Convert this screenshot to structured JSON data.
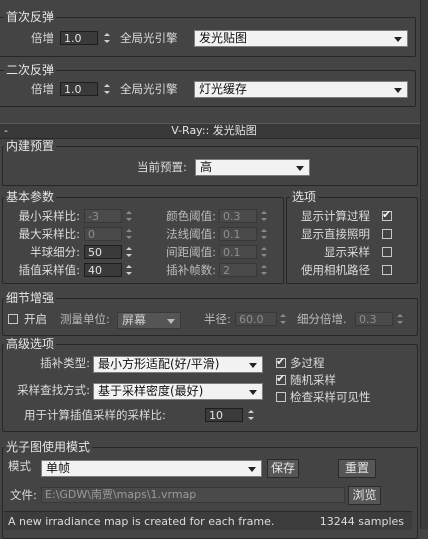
{
  "bounce1": {
    "title": "首次反弹",
    "multiplier_label": "倍增",
    "multiplier_value": "1.0",
    "engine_label": "全局光引擎",
    "engine_value": "发光贴图"
  },
  "bounce2": {
    "title": "二次反弹",
    "multiplier_label": "倍增",
    "multiplier_value": "1.0",
    "engine_label": "全局光引擎",
    "engine_value": "灯光缓存"
  },
  "rollout_title": "V-Ray:: 发光贴图",
  "preset": {
    "title": "内建预置",
    "current_label": "当前预置:",
    "current_value": "高"
  },
  "basic": {
    "title": "基本参数",
    "min_rate_label": "最小采样比:",
    "min_rate_value": "-3",
    "max_rate_label": "最大采样比:",
    "max_rate_value": "0",
    "hsph_label": "半球细分:",
    "hsph_value": "50",
    "interp_label": "插值采样值:",
    "interp_value": "40",
    "clr_thresh_label": "颜色阈值:",
    "clr_thresh_value": "0.3",
    "nrm_thresh_label": "法线阈值:",
    "nrm_thresh_value": "0.1",
    "dist_thresh_label": "间距阈值:",
    "dist_thresh_value": "0.1",
    "interp_frames_label": "插补帧数:",
    "interp_frames_value": "2"
  },
  "options": {
    "title": "选项",
    "show_calc_label": "显示计算过程",
    "show_calc_checked": true,
    "show_direct_label": "显示直接照明",
    "show_direct_checked": false,
    "show_samples_label": "显示采样",
    "show_samples_checked": false,
    "use_camera_label": "使用相机路径",
    "use_camera_checked": false
  },
  "detail": {
    "title": "细节增强",
    "on_label": "开启",
    "on_checked": false,
    "scale_label": "测量单位:",
    "scale_value": "屏幕",
    "radius_label": "半径:",
    "radius_value": "60.0",
    "subdiv_label": "细分倍增.",
    "subdiv_value": "0.3"
  },
  "advanced": {
    "title": "高级选项",
    "interp_type_label": "插补类型:",
    "interp_type_value": "最小方形适配(好/平滑)",
    "lookup_label": "采样查找方式:",
    "lookup_value": "基于采样密度(最好)",
    "calc_interp_label": "用于计算插值采样的采样比:",
    "calc_interp_value": "10",
    "multipass_label": "多过程",
    "multipass_checked": true,
    "randomize_label": "随机采样",
    "randomize_checked": true,
    "check_vis_label": "检查采样可见性",
    "check_vis_checked": false
  },
  "mode": {
    "title": "光子图使用模式",
    "mode_label": "模式",
    "mode_value": "单帧",
    "save_label": "保存",
    "reset_label": "重置",
    "file_label": "文件:",
    "file_value": "E:\\GDW\\南贾\\maps\\1.vrmap",
    "browse_label": "浏览",
    "status_text": "A new irradiance map is created for each frame.",
    "samples_text": "13244 samples"
  },
  "icons": {
    "check": "✔"
  }
}
